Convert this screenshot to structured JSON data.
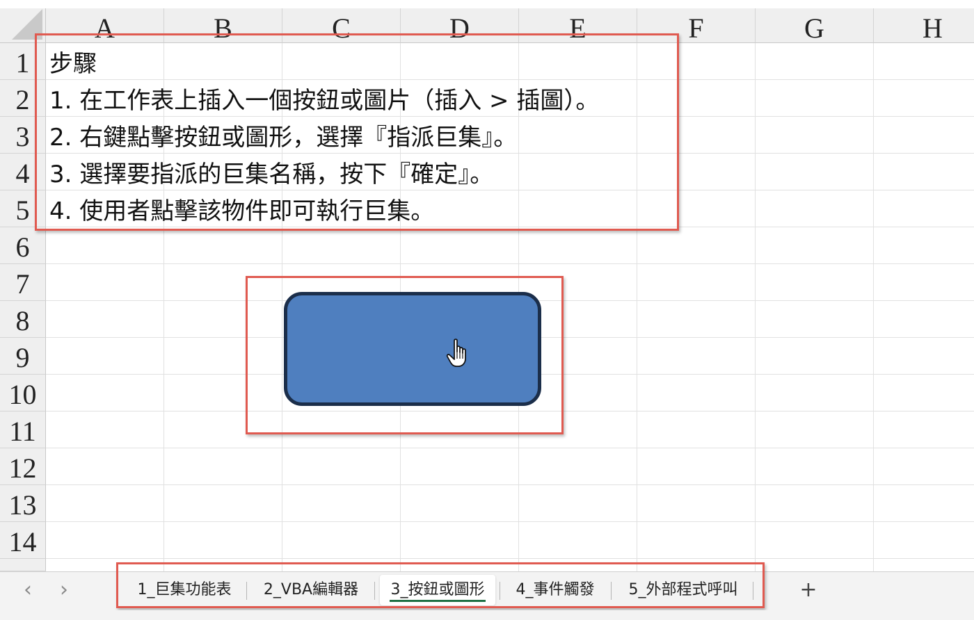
{
  "sheet": {
    "columns": [
      "A",
      "B",
      "C",
      "D",
      "E",
      "F",
      "G",
      "H"
    ],
    "rows": [
      "1",
      "2",
      "3",
      "4",
      "5",
      "6",
      "7",
      "8",
      "9",
      "10",
      "11",
      "12",
      "13",
      "14"
    ],
    "cells": {
      "A1": "步驟",
      "A2": "1. 在工作表上插入一個按鈕或圖片（插入 > 插圖）。",
      "A3": "2. 右鍵點擊按鈕或圖形，選擇『指派巨集』。",
      "A4": "3. 選擇要指派的巨集名稱，按下『確定』。",
      "A5": "4. 使用者點擊該物件即可執行巨集。"
    }
  },
  "shape": {
    "fill_color": "#4f7fbf",
    "border_color": "#1b2e4a",
    "cursor_icon": "hand-pointer-icon"
  },
  "highlight_color": "#e05a50",
  "tabs": {
    "prev_icon": "‹",
    "next_icon": "›",
    "items": [
      {
        "label": "1_巨集功能表"
      },
      {
        "label": "2_VBA編輯器"
      },
      {
        "label": "3_按鈕或圖形"
      },
      {
        "label": "4_事件觸發"
      },
      {
        "label": "5_外部程式呼叫"
      }
    ],
    "active_index": 2,
    "active_underline_color": "#1e7145",
    "add_icon": "+"
  }
}
